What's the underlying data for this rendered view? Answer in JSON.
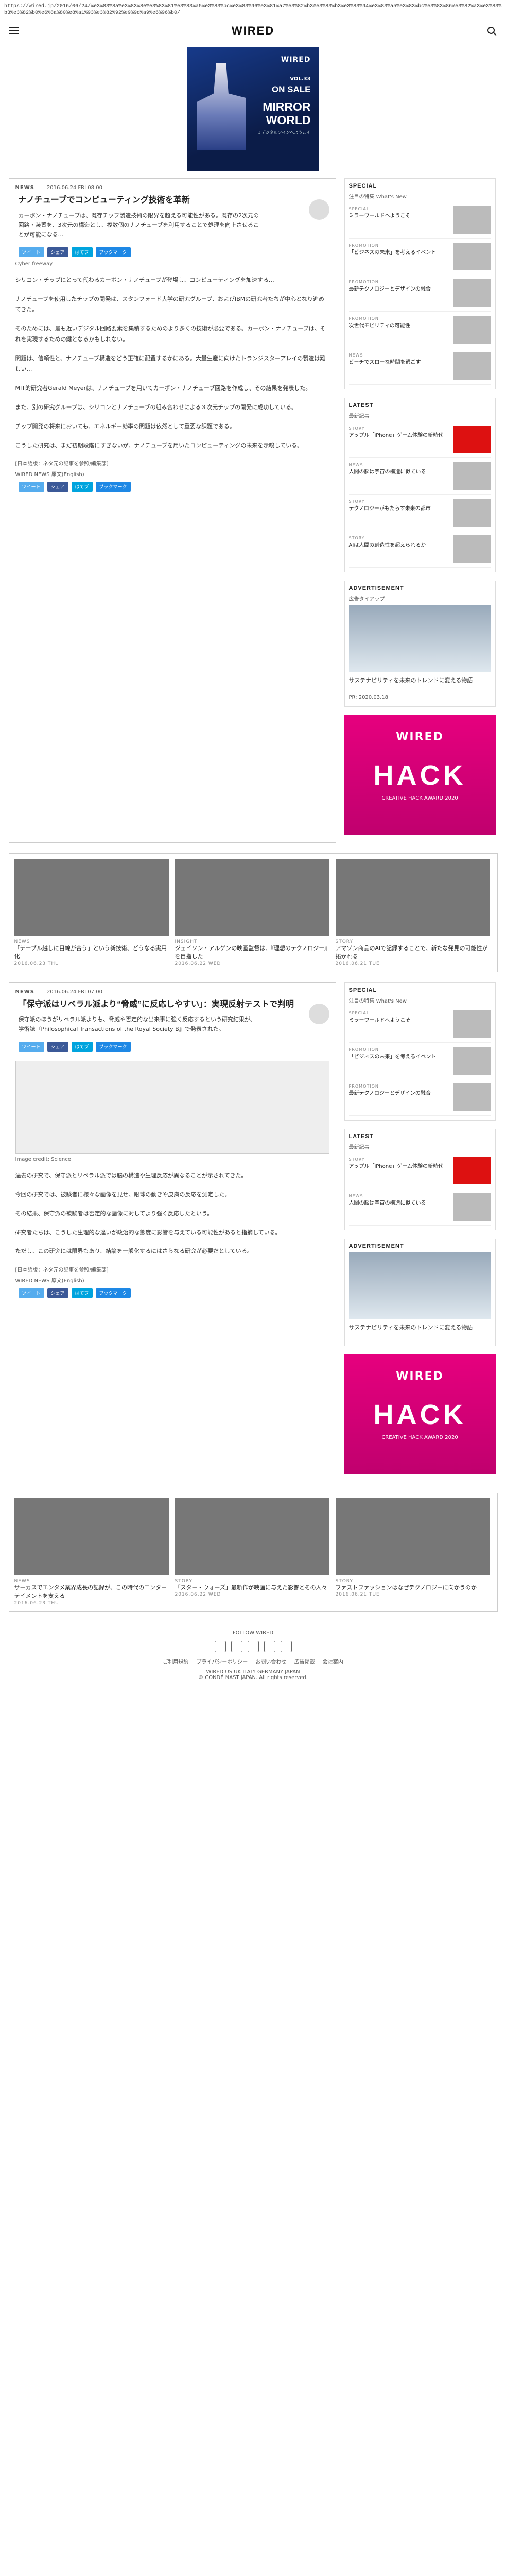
{
  "browser": {
    "url": "https://wired.jp/2016/06/24/%e3%83%8a%e3%83%8e%e3%83%81%e3%83%a5%e3%83%bc%e3%83%96%e3%81%a7%e3%82%b3%e3%83%b3%e3%83%94%e3%83%a5%e3%83%bc%e3%83%86%e3%82%a3%e3%83%b3%e3%82%b0%e6%8a%80%e8%a1%93%e3%82%92%e9%9d%a9%e6%96%b0/"
  },
  "header": {
    "logo": "WIRED"
  },
  "banner": {
    "brand": "WIRED",
    "vol": "VOL.33",
    "onsale": "ON SALE",
    "title1": "MIRROR",
    "title2": "WORLD",
    "subtitle": "#デジタルツインへようこそ"
  },
  "article1": {
    "category": "NEWS",
    "date": "2016.06.24 FRI 08:00",
    "title": "ナノチューブでコンピューティング技術を革新",
    "lead": "カーボン・ナノチューブは、既存チップ製造技術の限界を超える可能性がある。既存の2次元の回路・装置を、3次元の構造とし、複数個のナノチューブを利用することで処理を向上させることが可能になる…",
    "caption": "Cyber freeway",
    "paragraphs": [
      "シリコン・チップにとって代わるカーボン・ナノチューブが登場し、コンピューティングを加速する…",
      "ナノチューブを使用したチップの開発は、スタンフォード大学の研究グループ、およびIBMの研究者たちが中心となり進めてきた。",
      "そのためには、最も近いデジタル回路要素を集積するためのより多くの技術が必要である。カーボン・ナノチューブは、それを実現するための鍵となるかもしれない。",
      "問題は、信頼性と、ナノチューブ構造をどう正確に配置するかにある。大量生産に向けたトランジスターアレイの製造は難しい…",
      "MIT的研究者Gerald Meyerは、ナノチューブを用いてカーボン・ナノチューブ回路を作成し、その結果を発表した。",
      "また、別の研究グループは、シリコンとナノチューブの組み合わせによる３次元チップの開発に成功している。",
      "チップ開発の将来においても、エネルギー効率の問題は依然として重要な課題である。",
      "こうした研究は、まだ初期段階にすぎないが、ナノチューブを用いたコンピューティングの未来を示唆している。"
    ],
    "source": "[日本語版：ネタ元の記事を参照/編集部]",
    "credit": "WIRED NEWS 原文(English)"
  },
  "share": {
    "tweet": "ツイート",
    "facebook": "シェア",
    "hatena": "はてブ",
    "pocket": "ブックマーク"
  },
  "article2": {
    "category": "NEWS",
    "date": "2016.06.24 FRI 07:00",
    "title": "「保守派はリベラル派より“脅威”に反応しやすい」：実現反射テストで判明",
    "lead": "保守派のほうがリベラル派よりも、脅威や否定的な出来事に強く反応するという研究結果が、学術誌『Philosophical Transactions of the Royal Society B』で発表された。",
    "image_caption": "Image credit: Science",
    "paragraphs": [
      "過去の研究で、保守派とリベラル派では脳の構造や生理反応が異なることが示されてきた。",
      "今回の研究では、被験者に様々な画像を見せ、眼球の動きや皮膚の反応を測定した。",
      "その結果、保守派の被験者は否定的な画像に対してより強く反応したという。",
      "研究者たちは、こうした生理的な違いが政治的な態度に影響を与えている可能性があると指摘している。",
      "ただし、この研究には限界もあり、結論を一般化するにはさらなる研究が必要だとしている。"
    ],
    "source": "[日本語版：ネタ元の記事を参照/編集部]",
    "credit": "WIRED NEWS 原文(English)"
  },
  "sidebar": {
    "special_title": "SPECIAL",
    "special_sub": "注目の特集 What's New",
    "special_items": [
      {
        "label": "SPECIAL",
        "text": "ミラーワールドへようこそ"
      },
      {
        "label": "PROMOTION",
        "text": "「ビジネスの未来」を考えるイベント"
      },
      {
        "label": "PROMOTION",
        "text": "最新テクノロジーとデザインの融合"
      },
      {
        "label": "PROMOTION",
        "text": "次世代モビリティの可能性"
      },
      {
        "label": "NEWS",
        "text": "ビーチでスローな時間を過ごす"
      }
    ],
    "latest_title": "LATEST",
    "latest_sub": "最新記事",
    "latest_items": [
      {
        "label": "STORY",
        "text": "アップル「iPhone」ゲーム体験の新時代"
      },
      {
        "label": "NEWS",
        "text": "人間の脳は宇宙の構造に似ている"
      },
      {
        "label": "STORY",
        "text": "テクノロジーがもたらす未来の都市"
      },
      {
        "label": "STORY",
        "text": "AIは人間の創造性を超えられるか"
      }
    ],
    "ad_title": "ADVERTISEMENT",
    "ad_sub": "広告タイアップ",
    "ad_text": "サステナビリティを未来のトレンドに変える物語",
    "ad_date": "PR: 2020.03.18",
    "hack_brand": "WIRED",
    "hack_word": "HACK",
    "hack_sub": "CREATIVE HACK AWARD 2020"
  },
  "related_top": {
    "items": [
      {
        "label": "NEWS",
        "text": "「テーブル越しに目線が合う」という新技術、どうなる実用化",
        "date": "2016.06.23 THU"
      },
      {
        "label": "INSIGHT",
        "text": "ジェイソン・アルゲンの映画監督は、『理想のテクノロジー』を目指した",
        "date": "2016.06.22 WED"
      },
      {
        "label": "STORY",
        "text": "アマゾン商品のAIで記録することで、新たな発見の可能性が拓かれる",
        "date": "2016.06.21 TUE"
      }
    ]
  },
  "related_bottom": {
    "items": [
      {
        "label": "NEWS",
        "text": "サーカスでエンタメ業界成長の記録が、この時代のエンターテイメントを支える",
        "date": "2016.06.23 THU"
      },
      {
        "label": "STORY",
        "text": "「スター・ウォーズ」最新作が映画に与えた影響とその人々",
        "date": "2016.06.22 WED"
      },
      {
        "label": "STORY",
        "text": "ファストファッションはなぜテクノロジーに向かうのか",
        "date": "2016.06.21 TUE"
      }
    ]
  },
  "footer": {
    "follow": "FOLLOW WIRED",
    "links": [
      "ご利用規約",
      "プライバシーポリシー",
      "お問い合わせ",
      "広告掲載",
      "会社案内"
    ],
    "editions": "WIRED  US  UK  ITALY  GERMANY  JAPAN",
    "copyright": "© CONDÉ NAST JAPAN. All rights reserved."
  }
}
